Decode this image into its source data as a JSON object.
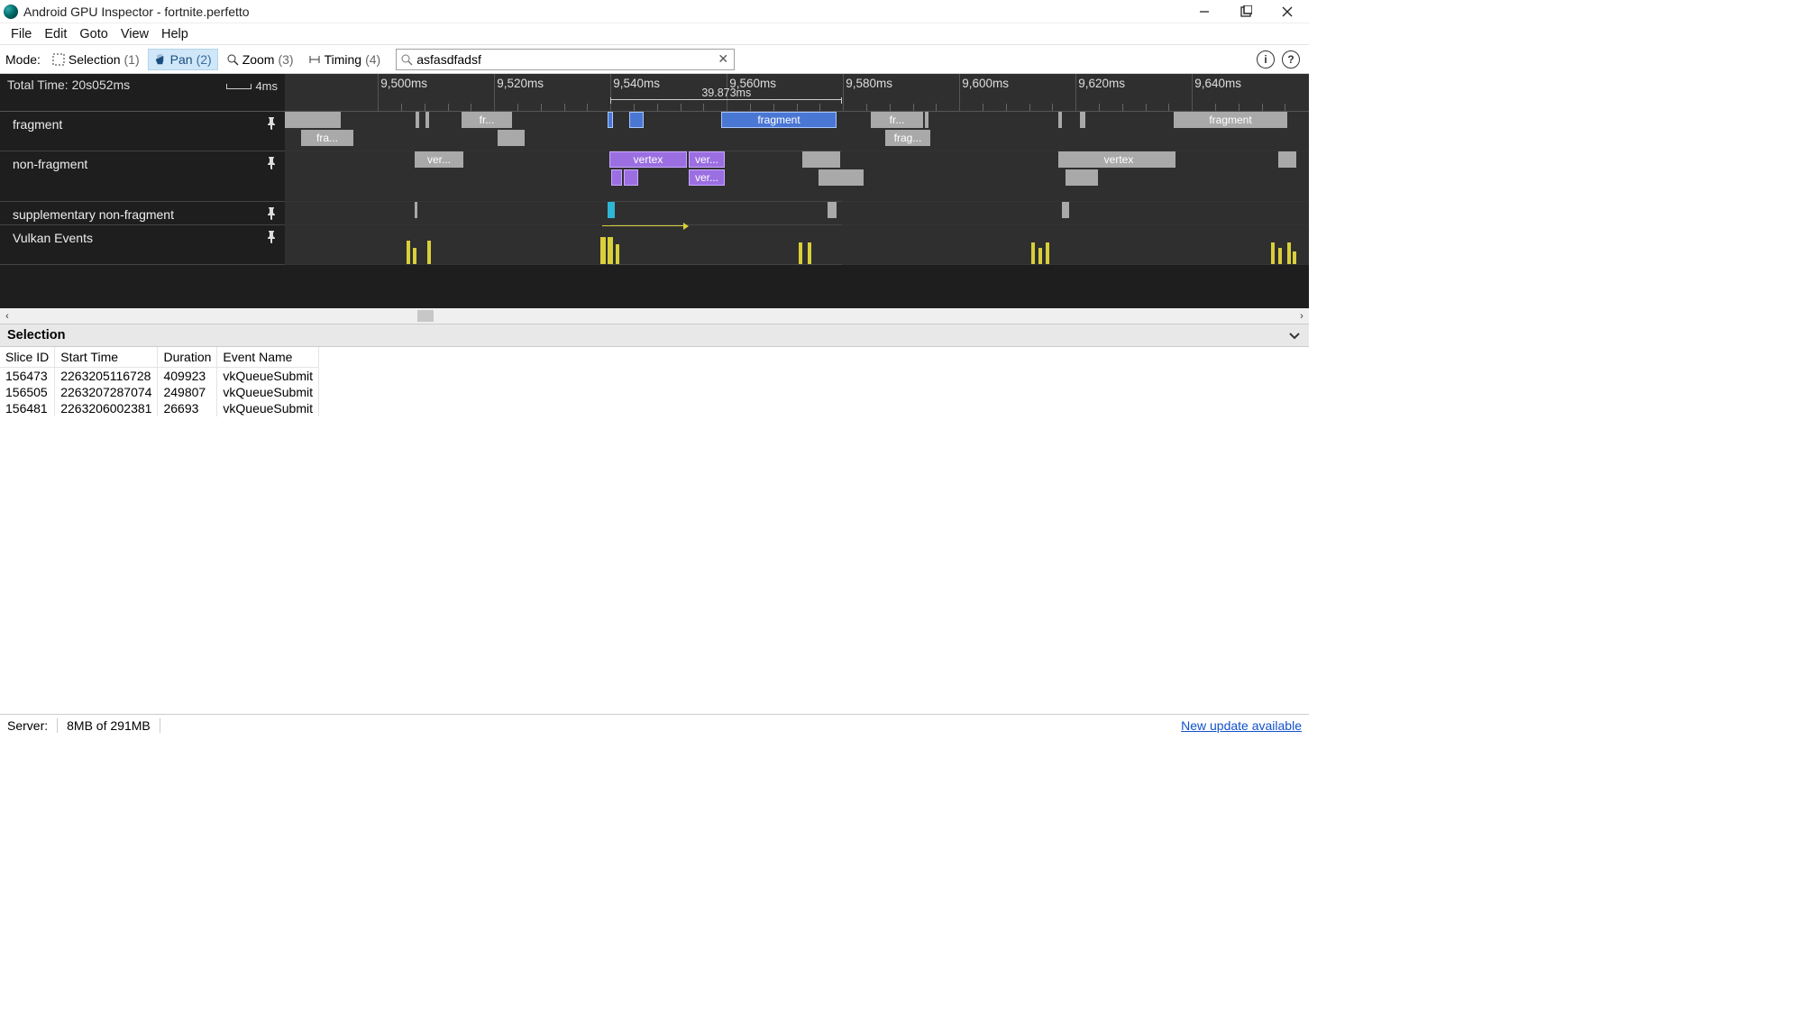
{
  "window": {
    "title": "Android GPU Inspector - fortnite.perfetto"
  },
  "menu": [
    "File",
    "Edit",
    "Goto",
    "View",
    "Help"
  ],
  "toolbar": {
    "modeLabel": "Mode:",
    "modes": [
      {
        "label": "Selection",
        "shortcut": "(1)",
        "icon": "selection-icon"
      },
      {
        "label": "Pan",
        "shortcut": "(2)",
        "icon": "pan-icon",
        "active": true
      },
      {
        "label": "Zoom",
        "shortcut": "(3)",
        "icon": "zoom-icon"
      },
      {
        "label": "Timing",
        "shortcut": "(4)",
        "icon": "timing-icon"
      }
    ],
    "searchValue": "asfasdfadsf"
  },
  "timeline": {
    "totalTime": "Total Time: 20s052ms",
    "scaleLabel": "4ms",
    "ticks": [
      "9,500ms",
      "9,520ms",
      "9,540ms",
      "9,560ms",
      "9,580ms",
      "9,600ms",
      "9,620ms",
      "9,640ms"
    ],
    "measureLabel": "39.873ms",
    "tracks": [
      {
        "name": "fragment"
      },
      {
        "name": "non-fragment"
      },
      {
        "name": "supplementary non-fragment"
      },
      {
        "name": "Vulkan Events"
      }
    ],
    "blockLabels": {
      "fra": "fra...",
      "fr": "fr...",
      "frag": "frag...",
      "fragment": "fragment",
      "ver": "ver...",
      "vertex": "vertex"
    }
  },
  "selection": {
    "title": "Selection",
    "columns": [
      "Slice ID",
      "Start Time",
      "Duration",
      "Event Name"
    ],
    "rows": [
      [
        "156473",
        "2263205116728",
        "409923",
        "vkQueueSubmit"
      ],
      [
        "156505",
        "2263207287074",
        "249807",
        "vkQueueSubmit"
      ],
      [
        "156481",
        "2263206002381",
        "26693",
        "vkQueueSubmit"
      ]
    ]
  },
  "status": {
    "serverLabel": "Server:",
    "memory": "8MB of 291MB",
    "update": "New update available"
  }
}
